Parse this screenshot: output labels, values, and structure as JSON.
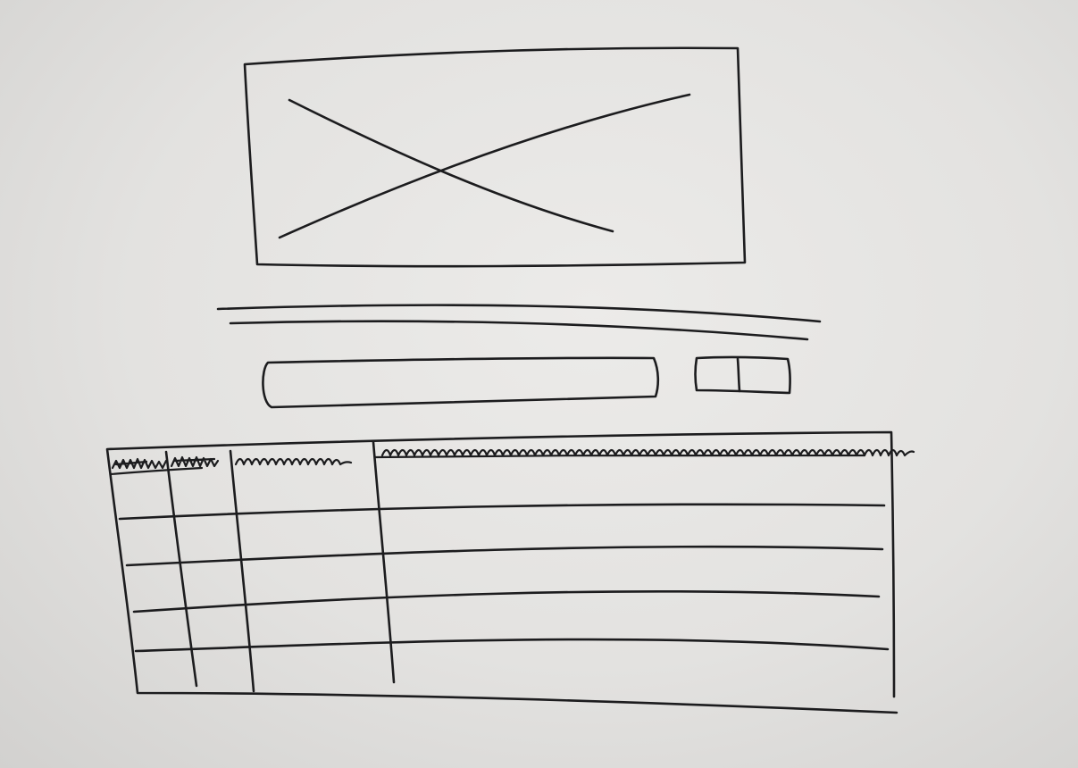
{
  "sketch": {
    "kind": "hand-drawn wireframe",
    "ink_color": "#1c1c1e",
    "paper_color": "#e6e5e3"
  },
  "image_placeholder": {
    "icon": "image-placeholder-x-icon"
  },
  "text_block": {
    "line_count": 2
  },
  "search_row": {
    "input": {
      "value": "",
      "placeholder": ""
    },
    "button_group": {
      "segment_count": 2
    }
  },
  "table": {
    "column_count": 4,
    "header_scribbled": true,
    "body_row_count": 5
  }
}
